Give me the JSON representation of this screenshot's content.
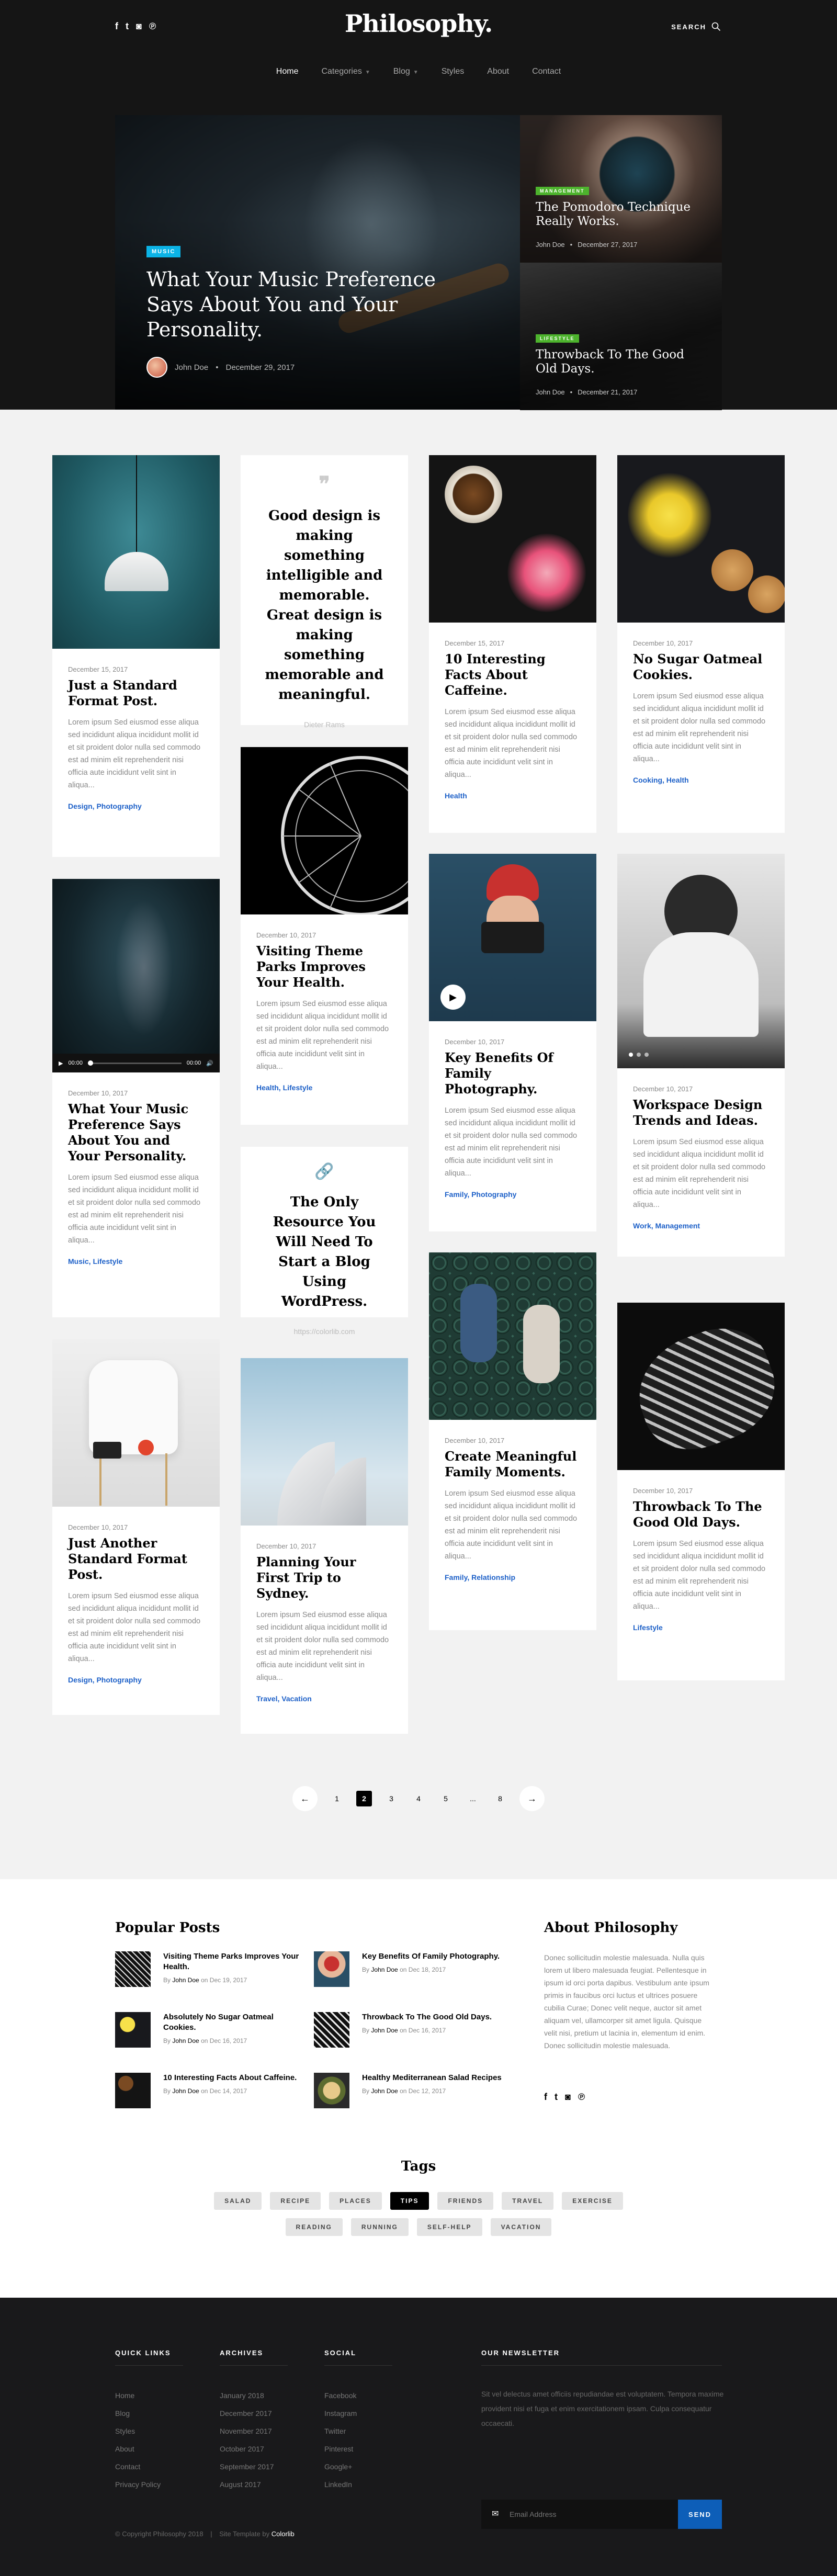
{
  "header": {
    "logo": "Philosophy.",
    "search_label": "SEARCH",
    "social": [
      "f",
      "t",
      "◙",
      "℗"
    ],
    "nav": [
      {
        "label": "Home",
        "active": true,
        "dropdown": false
      },
      {
        "label": "Categories",
        "active": false,
        "dropdown": true
      },
      {
        "label": "Blog",
        "active": false,
        "dropdown": true
      },
      {
        "label": "Styles",
        "active": false,
        "dropdown": false
      },
      {
        "label": "About",
        "active": false,
        "dropdown": false
      },
      {
        "label": "Contact",
        "active": false,
        "dropdown": false
      }
    ]
  },
  "featured": {
    "main": {
      "category": "MUSIC",
      "title": "What Your Music Preference Says About You and Your Personality.",
      "author": "John Doe",
      "date": "December 29, 2017"
    },
    "side": [
      {
        "category": "MANAGEMENT",
        "title": "The Pomodoro Technique Really Works.",
        "author": "John Doe",
        "date": "December 27, 2017"
      },
      {
        "category": "LIFESTYLE",
        "title": "Throwback To The Good Old Days.",
        "author": "John Doe",
        "date": "December 21, 2017"
      }
    ]
  },
  "posts": {
    "excerpt": "Lorem ipsum Sed eiusmod esse aliqua sed incididunt aliqua incididunt mollit id et sit proident dolor nulla sed commodo est ad minim elit reprehenderit nisi officia aute incididunt velit sint in aliqua...",
    "lamp": {
      "date": "December 15, 2017",
      "title": "Just a Standard Format Post.",
      "cats": "Design, Photography"
    },
    "audio": {
      "date": "December 10, 2017",
      "title": "What Your Music Preference Says About You and Your Personality.",
      "cats": "Music, Lifestyle",
      "time_start": "00:00",
      "time_end": "00:00"
    },
    "chair": {
      "date": "December 10, 2017",
      "title": "Just Another Standard Format Post.",
      "cats": "Design, Photography"
    },
    "quote": {
      "text": "Good design is making something intelligible and memorable. Great design is making something memorable and meaningful.",
      "cite": "Dieter Rams"
    },
    "wheel": {
      "date": "December 10, 2017",
      "title": "Visiting Theme Parks Improves Your Health.",
      "cats": "Health, Lifestyle"
    },
    "link": {
      "title": "The Only Resource You Will Need To Start a Blog Using WordPress.",
      "url": "https://colorlib.com"
    },
    "sydney": {
      "date": "December 10, 2017",
      "title": "Planning Your First Trip to Sydney.",
      "cats": "Travel, Vacation"
    },
    "coffee": {
      "date": "December 15, 2017",
      "title": "10 Interesting Facts About Caffeine.",
      "cats": "Health"
    },
    "family": {
      "date": "December 10, 2017",
      "title": "Key Benefits Of Family Photography.",
      "cats": "Family, Photography"
    },
    "jump": {
      "date": "December 10, 2017",
      "title": "Create Meaningful Family Moments.",
      "cats": "Family, Relationship"
    },
    "cookies": {
      "date": "December 10, 2017",
      "title": "No Sugar Oatmeal Cookies.",
      "cats": "Cooking, Health"
    },
    "workspace": {
      "date": "December 10, 2017",
      "title": "Workspace Design Trends and Ideas.",
      "cats": "Work, Management"
    },
    "car": {
      "date": "December 10, 2017",
      "title": "Throwback To The Good Old Days.",
      "cats": "Lifestyle"
    }
  },
  "pagination": {
    "prev": "←",
    "next": "→",
    "pages": [
      "1",
      "2",
      "3",
      "4",
      "5",
      "...",
      "8"
    ],
    "current": "2"
  },
  "popular": {
    "heading": "Popular Posts",
    "by": "By",
    "on": "on",
    "items": [
      {
        "title": "Visiting Theme Parks Improves Your Health.",
        "author": "John Doe",
        "date": "Dec 19, 2017"
      },
      {
        "title": "Key Benefits Of Family Photography.",
        "author": "John Doe",
        "date": "Dec 18, 2017"
      },
      {
        "title": "Absolutely No Sugar Oatmeal Cookies.",
        "author": "John Doe",
        "date": "Dec 16, 2017"
      },
      {
        "title": "Throwback To The Good Old Days.",
        "author": "John Doe",
        "date": "Dec 16, 2017"
      },
      {
        "title": "10 Interesting Facts About Caffeine.",
        "author": "John Doe",
        "date": "Dec 14, 2017"
      },
      {
        "title": "Healthy Mediterranean Salad Recipes",
        "author": "John Doe",
        "date": "Dec 12, 2017"
      }
    ]
  },
  "about": {
    "heading": "About Philosophy",
    "text": "Donec sollicitudin molestie malesuada. Nulla quis lorem ut libero malesuada feugiat. Pellentesque in ipsum id orci porta dapibus. Vestibulum ante ipsum primis in faucibus orci luctus et ultrices posuere cubilia Curae; Donec velit neque, auctor sit amet aliquam vel, ullamcorper sit amet ligula. Quisque velit nisi, pretium ut lacinia in, elementum id enim. Donec sollicitudin molestie malesuada."
  },
  "tags": {
    "heading": "Tags",
    "items": [
      "SALAD",
      "RECIPE",
      "PLACES",
      "TIPS",
      "FRIENDS",
      "TRAVEL",
      "EXERCISE",
      "READING",
      "RUNNING",
      "SELF-HELP",
      "VACATION"
    ],
    "active": "TIPS"
  },
  "footer": {
    "quick_links": {
      "heading": "QUICK LINKS",
      "items": [
        "Home",
        "Blog",
        "Styles",
        "About",
        "Contact",
        "Privacy Policy"
      ]
    },
    "archives": {
      "heading": "ARCHIVES",
      "items": [
        "January 2018",
        "December 2017",
        "November 2017",
        "October 2017",
        "September 2017",
        "August 2017"
      ]
    },
    "social": {
      "heading": "SOCIAL",
      "items": [
        "Facebook",
        "Instagram",
        "Twitter",
        "Pinterest",
        "Google+",
        "LinkedIn"
      ]
    },
    "newsletter": {
      "heading": "OUR NEWSLETTER",
      "text": "Sit vel delectus amet officiis repudiandae est voluptatem. Tempora maxime provident nisi et fuga et enim exercitationem ipsam. Culpa consequatur occaecati.",
      "placeholder": "Email Address",
      "button": "SEND"
    },
    "copyright": "© Copyright Philosophy 2018",
    "template_by": "Site Template by",
    "template_author": "Colorlib"
  },
  "colors": {
    "accent": "#1e61c8",
    "music_badge": "#0bb3e6",
    "side_badge": "#4db32d",
    "send_button": "#0d5eb8"
  }
}
